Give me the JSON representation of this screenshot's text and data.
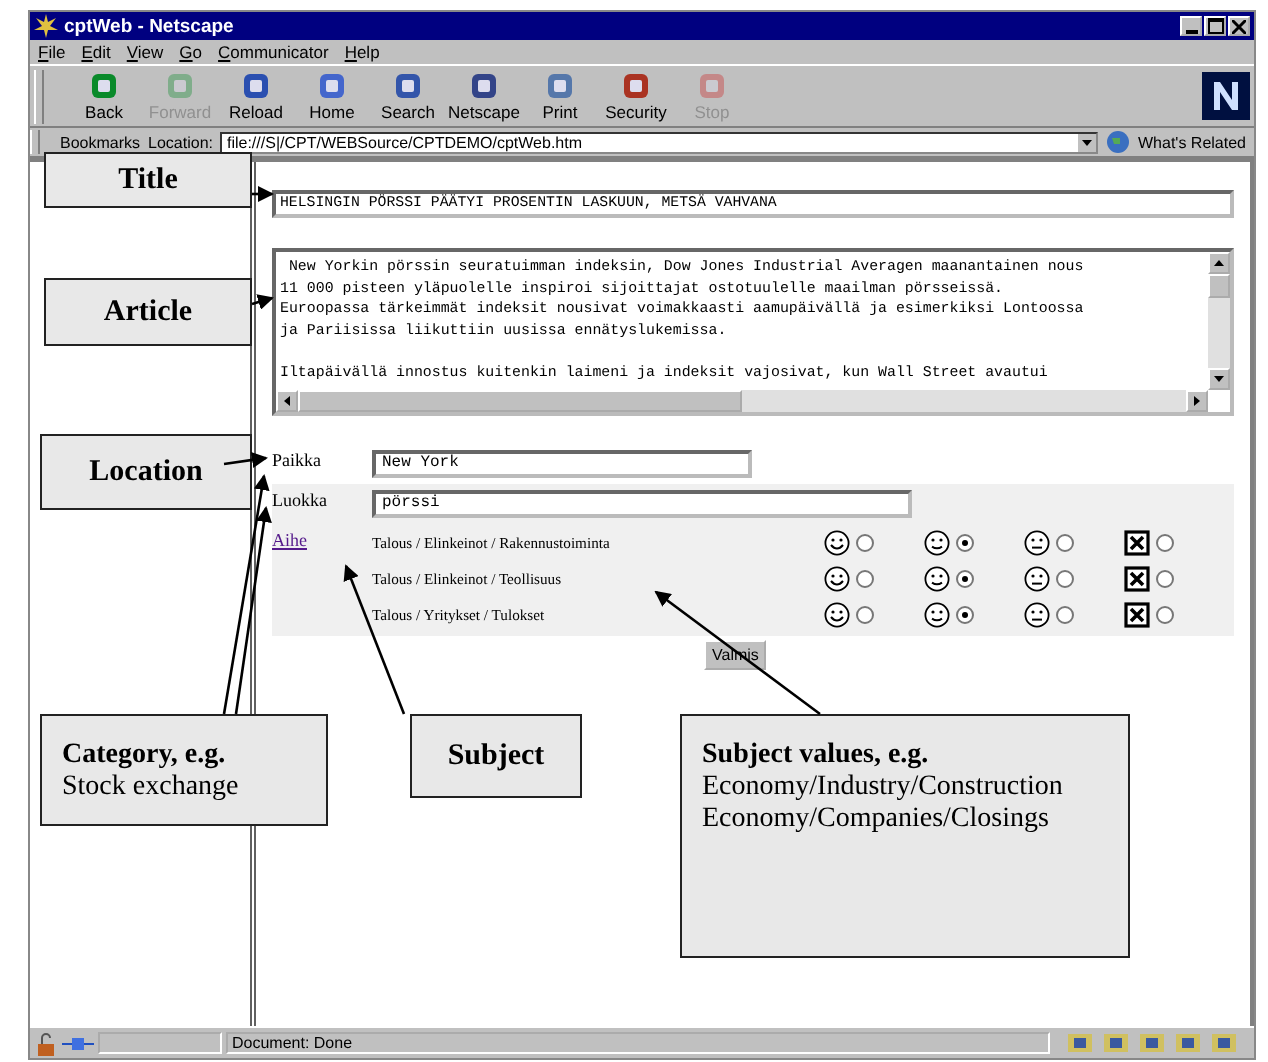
{
  "window": {
    "title": "cptWeb - Netscape"
  },
  "menu": [
    "File",
    "Edit",
    "View",
    "Go",
    "Communicator",
    "Help"
  ],
  "toolbar": [
    {
      "label": "Back",
      "disabled": false
    },
    {
      "label": "Forward",
      "disabled": true
    },
    {
      "label": "Reload",
      "disabled": false
    },
    {
      "label": "Home",
      "disabled": false
    },
    {
      "label": "Search",
      "disabled": false
    },
    {
      "label": "Netscape",
      "disabled": false
    },
    {
      "label": "Print",
      "disabled": false
    },
    {
      "label": "Security",
      "disabled": false
    },
    {
      "label": "Stop",
      "disabled": true
    }
  ],
  "location_bar": {
    "bookmarks": "Bookmarks",
    "label": "Location:",
    "url": "file:///S|/CPT/WEBSource/CPTDEMO/cptWeb.htm",
    "related": "What's Related"
  },
  "form": {
    "title_value": "HELSINGIN PÖRSSI PÄÄTYI PROSENTIN LASKUUN, METSÄ VAHVANA",
    "article_paragraphs": [
      [
        " New Yorkin pörssin seuratuimman indeksin, Dow Jones Industrial Averagen maanantainen nous",
        "11 000 pisteen yläpuolelle inspiroi sijoittajat ostotuulelle maailman pörsseissä.",
        "Euroopassa tärkeimmät indeksit nousivat voimakkaasti aamupäivällä ja esimerkiksi Lontoossa",
        "ja Pariisissa liikuttiin uusissa ennätyslukemissa."
      ],
      [
        "Iltapäivällä innostus kuitenkin laimeni ja indeksit vajosivat, kun Wall Street avautui"
      ]
    ],
    "place_label": "Paikka",
    "place_value": "New York",
    "class_label": "Luokka",
    "class_value": "pörssi",
    "subject_link": "Aihe",
    "subjects": [
      {
        "label": "Talous / Elinkeinot / Rakennustoiminta",
        "ratings": [
          {
            "kind": "smile",
            "selected": false
          },
          {
            "kind": "slight",
            "selected": true
          },
          {
            "kind": "neutral",
            "selected": false
          },
          {
            "kind": "reject",
            "selected": false
          }
        ]
      },
      {
        "label": "Talous / Elinkeinot / Teollisuus",
        "ratings": [
          {
            "kind": "smile",
            "selected": false
          },
          {
            "kind": "slight",
            "selected": true
          },
          {
            "kind": "neutral",
            "selected": false
          },
          {
            "kind": "reject",
            "selected": false
          }
        ]
      },
      {
        "label": "Talous / Yritykset / Tulokset",
        "ratings": [
          {
            "kind": "smile",
            "selected": false
          },
          {
            "kind": "slight",
            "selected": true
          },
          {
            "kind": "neutral",
            "selected": false
          },
          {
            "kind": "reject",
            "selected": false
          }
        ]
      }
    ],
    "submit": "Valmis"
  },
  "status_bar": {
    "text": "Document: Done"
  },
  "annotations": [
    {
      "title": "Title"
    },
    {
      "title": "Article"
    },
    {
      "title": "Location"
    },
    {
      "title": "Category, e.g.",
      "lines": [
        "Stock exchange"
      ]
    },
    {
      "title": "Subject"
    },
    {
      "title": "Subject values, e.g.",
      "lines": [
        "Economy/Industry/Construction",
        "Economy/Companies/Closings"
      ]
    }
  ]
}
